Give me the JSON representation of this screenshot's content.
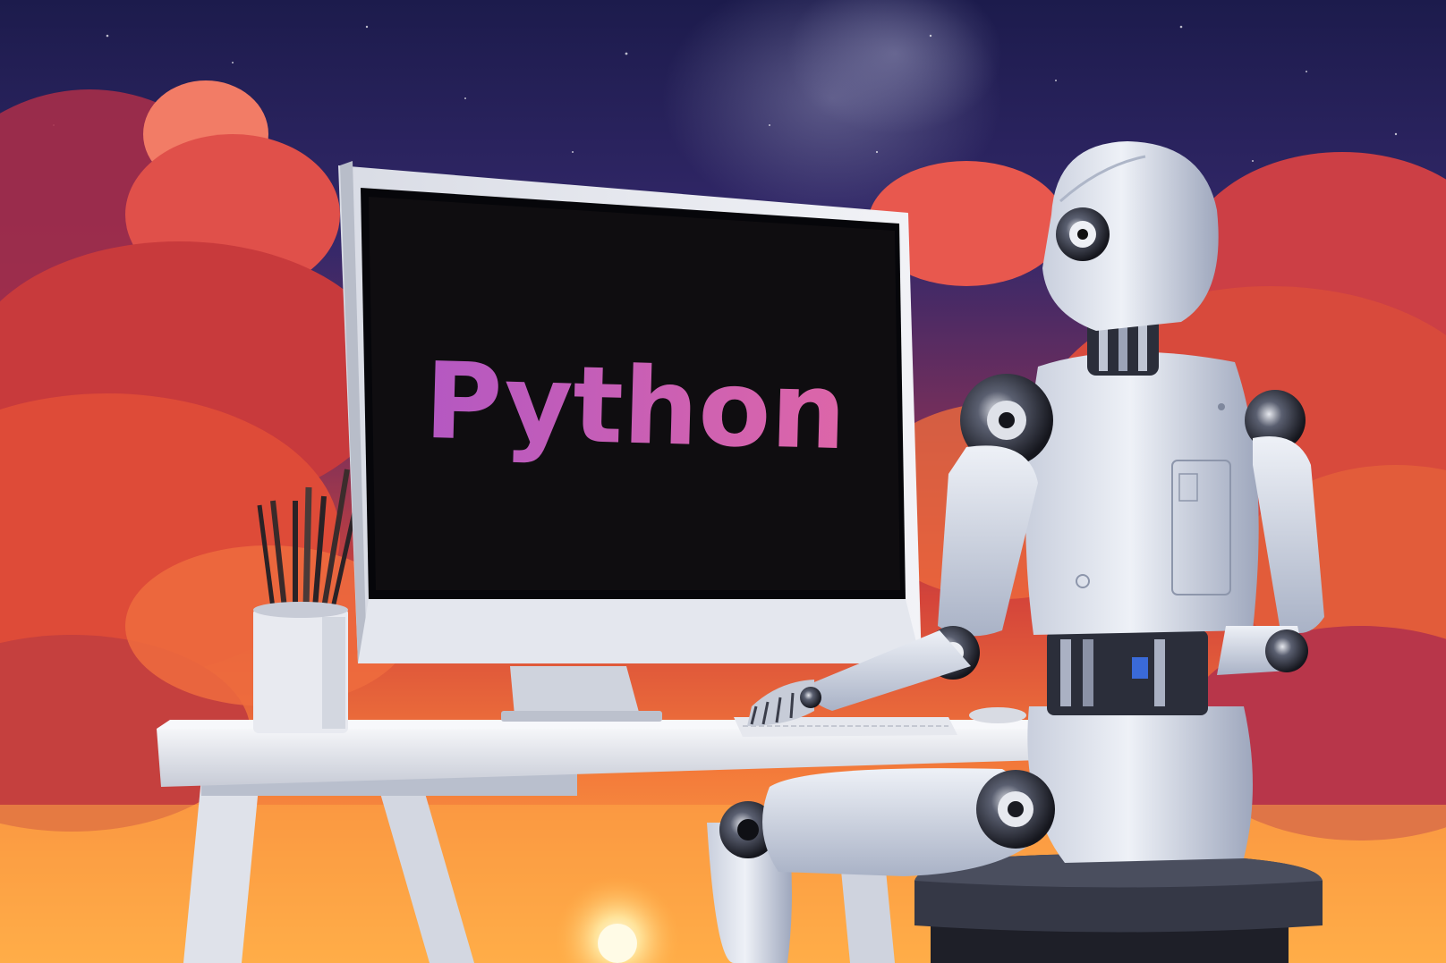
{
  "screen": {
    "text": "Python",
    "text_color": "#c25fc0",
    "screen_color": "#0f0d10"
  },
  "palette": {
    "sky_top": "#1e1d4f",
    "sky_mid": "#3d2a63",
    "cloud_red": "#d23a3a",
    "cloud_orange": "#f07040",
    "horizon_glow": "#ffb04a",
    "sun": "#fff2c0",
    "robot_white": "#e9edf4",
    "robot_shadow": "#9aa3b8",
    "joint_chrome": "#2b2e3a",
    "desk_white": "#eceef3"
  }
}
